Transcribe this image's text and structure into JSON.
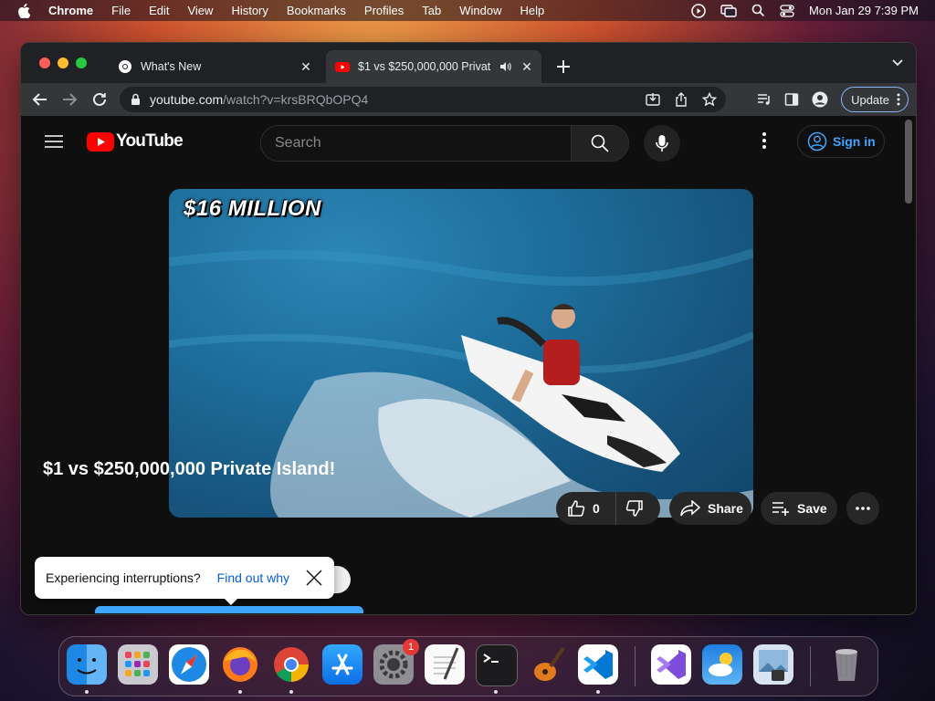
{
  "menubar": {
    "app": "Chrome",
    "items": [
      "File",
      "Edit",
      "View",
      "History",
      "Bookmarks",
      "Profiles",
      "Tab",
      "Window",
      "Help"
    ],
    "clock": "Mon Jan 29  7:39 PM"
  },
  "browser": {
    "tabs": [
      {
        "title": "What's New"
      },
      {
        "title": "$1 vs $250,000,000 Privat"
      }
    ],
    "url_host": "youtube.com",
    "url_path": "/watch?v=krsBRQbOPQ4",
    "update_label": "Update"
  },
  "youtube": {
    "logo_text": "YouTube",
    "search_placeholder": "Search",
    "signin_label": "Sign in",
    "video_caption": "$16 MILLION",
    "video_title": "$1 vs $250,000,000 Private Island!",
    "like_count": "0",
    "share_label": "Share",
    "save_label": "Save",
    "tooltip_message": "Experiencing interruptions?",
    "tooltip_link": "Find out why"
  },
  "dock": {
    "apps": [
      "finder",
      "launchpad",
      "safari",
      "firefox",
      "chrome",
      "app-store",
      "system-settings",
      "textedit",
      "terminal",
      "garageband",
      "vscode",
      "visual-studio",
      "weather",
      "preview",
      "trash"
    ],
    "settings_badge": "1"
  },
  "colors": {
    "youtube_red": "#ff0000",
    "link_blue": "#3ea6ff",
    "page_bg": "#0f0f0f"
  }
}
